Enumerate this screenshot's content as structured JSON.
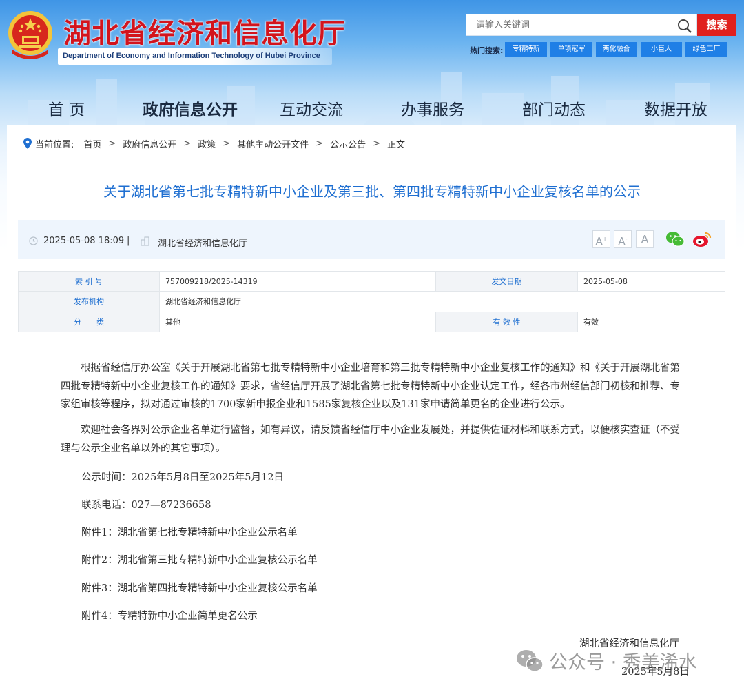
{
  "header": {
    "title": "湖北省经济和信息化厅",
    "subtitle": "Department of Economy and Information Technology of Hubei Province",
    "search_placeholder": "请输入关键词",
    "search_button": "搜索",
    "hot_label": "热门搜索:",
    "hot_tags": [
      "专精特新",
      "单项冠军",
      "两化融合",
      "小巨人",
      "绿色工厂"
    ]
  },
  "nav": {
    "items": [
      "首 页",
      "政府信息公开",
      "互动交流",
      "办事服务",
      "部门动态",
      "数据开放"
    ],
    "active": "政府信息公开"
  },
  "breadcrumb": {
    "label": "当前位置:",
    "items": [
      "首页",
      "政府信息公开",
      "政策",
      "其他主动公开文件",
      "公示公告",
      "正文"
    ],
    "separator": ">"
  },
  "article": {
    "title": "关于湖北省第七批专精特新中小企业及第三批、第四批专精特新中小企业复核名单的公示",
    "datetime": "2025-05-08 18:09",
    "divider": "|",
    "source": "湖北省经济和信息化厅",
    "font_buttons": [
      "A",
      "A",
      "A"
    ],
    "font_button_marks": [
      "+",
      "-",
      ""
    ]
  },
  "info_table": {
    "index_label": "索 引 号",
    "index_value": "757009218/2025-14319",
    "date_label": "发文日期",
    "date_value": "2025-05-08",
    "org_label": "发布机构",
    "org_value": "湖北省经济和信息化厅",
    "category_label": "分　　类",
    "category_value": "其他",
    "validity_label": "有 效 性",
    "validity_value": "有效"
  },
  "body": {
    "para1": "根据省经信厅办公室《关于开展湖北省第七批专精特新中小企业培育和第三批专精特新中小企业复核工作的通知》和《关于开展湖北省第四批专精特新中小企业复核工作的通知》要求，省经信厅开展了湖北省第七批专精特新中小企业认定工作，经各市州经信部门初核和推荐、专家组审核等程序，拟对通过审核的1700家新申报企业和1585家复核企业以及131家申请简单更名的企业进行公示。",
    "para2": "欢迎社会各界对公示企业名单进行监督，如有异议，请反馈省经信厅中小企业发展处，并提供佐证材料和联系方式，以便核实查证（不受理与公示企业名单以外的其它事项）。",
    "period": "公示时间：2025年5月8日至2025年5月12日",
    "phone": "联系电话：027—87236658",
    "attachments": [
      "附件1：湖北省第七批专精特新中小企业公示名单",
      "附件2：湖北省第三批专精特新中小企业复核公示名单",
      "附件3：湖北省第四批专精特新中小企业复核公示名单",
      "附件4：专精特新中小企业简单更名公示"
    ],
    "signature_org": "湖北省经济和信息化厅",
    "signature_date": "2025年5月8日"
  },
  "watermark": {
    "text": "公众号 · 秀美浠水"
  },
  "colors": {
    "brand_red": "#d3141d",
    "title_blue": "#1f6fd1",
    "tag_blue": "#1f7fe6",
    "search_red": "#e0201e"
  },
  "icons": [
    "national-emblem-icon",
    "search-icon",
    "location-pin-icon",
    "clock-icon",
    "building-icon",
    "wechat-icon",
    "weibo-icon"
  ]
}
